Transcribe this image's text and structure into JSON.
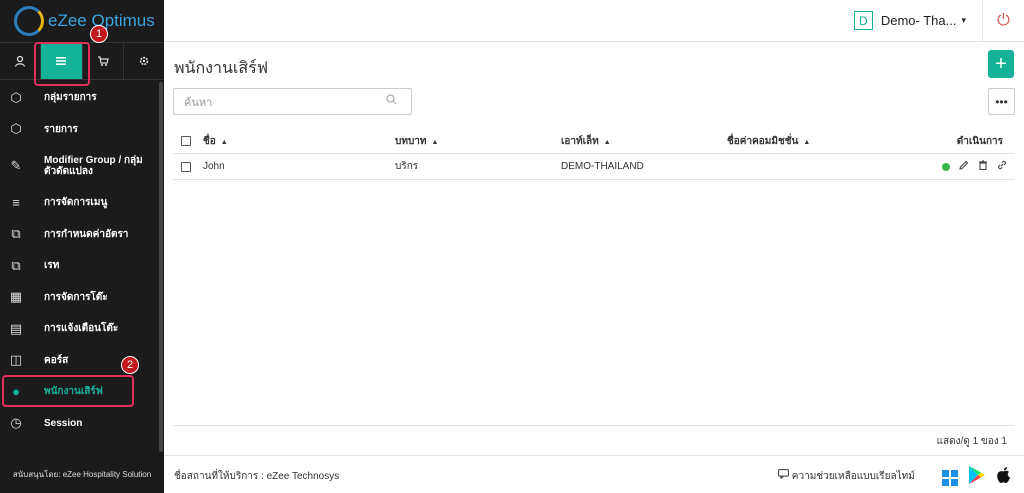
{
  "app": {
    "logo_text": "eZee Optimus"
  },
  "header": {
    "outlet_badge": "D",
    "outlet_name": "Demo- Tha...",
    "caret": "▾",
    "power_icon": "⏻"
  },
  "sidebar": {
    "top_icons": [
      "user-icon",
      "menu-icon",
      "cart-icon",
      "gear-icon"
    ],
    "items": [
      {
        "label": "กลุ่มรายการ",
        "icon": "⬡"
      },
      {
        "label": "รายการ",
        "icon": "⬡"
      },
      {
        "label": "Modifier Group / กลุ่มตัวดัดแปลง",
        "icon": "✎"
      },
      {
        "label": "การจัดการเมนู",
        "icon": "≡"
      },
      {
        "label": "การกำหนดค่าอัตรา",
        "icon": "⧉"
      },
      {
        "label": "เรท",
        "icon": "⧉"
      },
      {
        "label": "การจัดการโต๊ะ",
        "icon": "▦"
      },
      {
        "label": "การแจ้งเตือนโต๊ะ",
        "icon": "▤"
      },
      {
        "label": "คอร์ส",
        "icon": "◫"
      },
      {
        "label": "พนักงานเสิร์ฟ",
        "icon": "●"
      },
      {
        "label": "Session",
        "icon": "◷"
      }
    ],
    "footer": "สนับสนุนโดย: eZee Hospitality Solution"
  },
  "annotations": {
    "one": "1",
    "two": "2"
  },
  "main": {
    "title": "พนักงานเสิร์ฟ",
    "add_label": "+",
    "search_placeholder": "ค้นหา",
    "more_label": "•••",
    "columns": [
      "ชื่อ",
      "บทบาท",
      "เอาท์เล็ท",
      "ชื่อค่าคอมมิชชั่น",
      "ดำเนินการ"
    ],
    "sort_arrow": "▲",
    "rows": [
      {
        "name": "John",
        "role": "บริกร",
        "outlet": "DEMO-THAILAND",
        "commission": ""
      }
    ],
    "status_color": "#3ab54a",
    "page_info": "แสดง/ดู 1 ของ 1"
  },
  "footer": {
    "provider": "ชื่อสถานที่ให้บริการ : eZee Technosys",
    "help": "ความช่วยเหลือแบบเรียลไทม์",
    "accent": "#15b29a"
  }
}
